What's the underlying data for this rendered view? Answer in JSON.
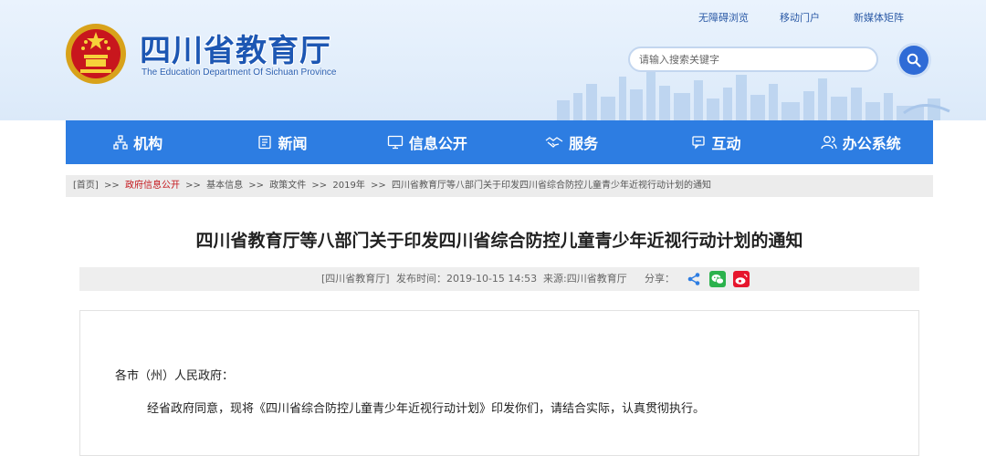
{
  "header": {
    "site_title": "四川省教育厅",
    "site_subtitle": "The Education Department Of Sichuan Province",
    "top_links": [
      "无障碍浏览",
      "移动门户",
      "新媒体矩阵"
    ],
    "search": {
      "placeholder": "请输入搜索关键字",
      "icon": "search-icon"
    },
    "emblem": "national-emblem"
  },
  "nav": {
    "items": [
      {
        "label": "机构",
        "icon": "org-chart-icon"
      },
      {
        "label": "新闻",
        "icon": "news-icon"
      },
      {
        "label": "信息公开",
        "icon": "monitor-icon"
      },
      {
        "label": "服务",
        "icon": "handshake-icon"
      },
      {
        "label": "互动",
        "icon": "chat-icon"
      },
      {
        "label": "办公系统",
        "icon": "users-icon"
      }
    ],
    "color": "#2d7de2"
  },
  "breadcrumb": {
    "items": [
      "[首页]",
      "政府信息公开",
      "基本信息",
      "政策文件",
      "2019年",
      "四川省教育厅等八部门关于印发四川省综合防控儿童青少年近视行动计划的通知"
    ],
    "separator": ">>",
    "highlight_color": "#c4161c"
  },
  "article": {
    "title": "四川省教育厅等八部门关于印发四川省综合防控儿童青少年近视行动计划的通知",
    "meta": {
      "source_tag": "[四川省教育厅]",
      "publish_time": "发布时间：2019-10-15 14:53",
      "from": "来源:四川省教育厅",
      "share_label": "分享：",
      "share_icons": [
        "share-icon",
        "wechat-icon",
        "weibo-icon"
      ]
    },
    "salutation": "各市（州）人民政府：",
    "paragraph": "经省政府同意，现将《四川省综合防控儿童青少年近视行动计划》印发你们，请结合实际，认真贯彻执行。"
  }
}
